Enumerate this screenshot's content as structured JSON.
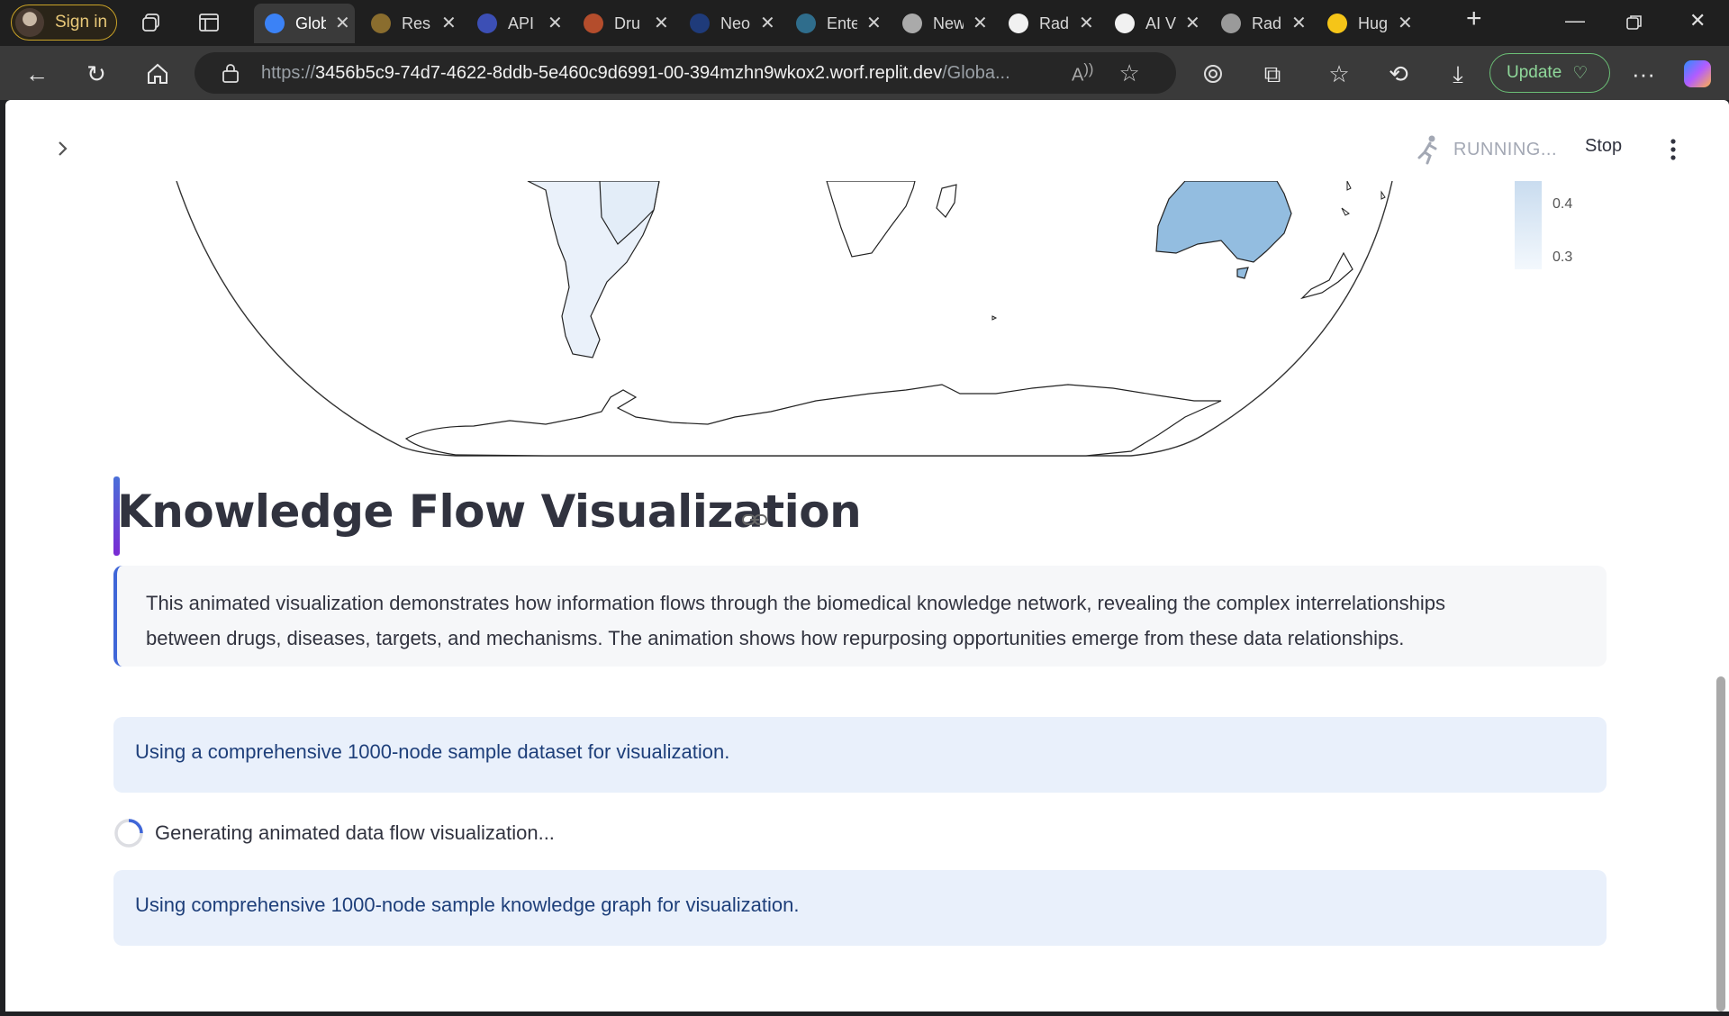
{
  "browser": {
    "signin_label": "Sign in",
    "tabs": [
      {
        "title": "Glob",
        "favicon": "globe-icon",
        "color": "#3b82f6",
        "active": true
      },
      {
        "title": "Res",
        "favicon": "hf-icon",
        "color": "#8a6d2e"
      },
      {
        "title": "API",
        "favicon": "api-icon",
        "color": "#3c4fb5"
      },
      {
        "title": "Dru",
        "favicon": "drug-icon",
        "color": "#b44d2c"
      },
      {
        "title": "Neo",
        "favicon": "neo-icon",
        "color": "#1f3b7a"
      },
      {
        "title": "Ente",
        "favicon": "enterprise-icon",
        "color": "#2f6d8c"
      },
      {
        "title": "New",
        "favicon": "newtab-icon",
        "color": "#aaaaaa"
      },
      {
        "title": "Rad",
        "favicon": "openai-icon",
        "color": "#f1f1f1"
      },
      {
        "title": "AI V",
        "favicon": "pause-icon",
        "color": "#f1f1f1"
      },
      {
        "title": "Rad",
        "favicon": "openai-icon",
        "color": "#9a9a9a"
      },
      {
        "title": "Hug",
        "favicon": "hugging-face-icon",
        "color": "#f5c518"
      }
    ],
    "url_prefix": "https://",
    "url_host": "3456b5c9-74d7-4622-8ddb-5e460c9d6991-00-394mzhn9wkox2.worf.replit.dev",
    "url_path": "/Globa...",
    "update_label": "Update"
  },
  "app": {
    "status": "RUNNING...",
    "stop_label": "Stop",
    "colorbar_ticks": [
      "0.4",
      "0.3"
    ],
    "heading": "Knowledge Flow Visualization",
    "description_line1": "This animated visualization demonstrates how information flows through the biomedical knowledge network, revealing the complex interrelationships",
    "description_line2": "between drugs, diseases, targets, and mechanisms. The animation shows how repurposing opportunities emerge from these data relationships.",
    "info1": "Using a comprehensive 1000-node sample dataset for visualization.",
    "spinner_text": "Generating animated data flow visualization...",
    "info2": "Using comprehensive 1000-node sample knowledge graph for visualization."
  },
  "colors": {
    "accent": "#3f66d8",
    "info_bg": "#e9f0fb",
    "australia_fill": "#93bde0"
  }
}
